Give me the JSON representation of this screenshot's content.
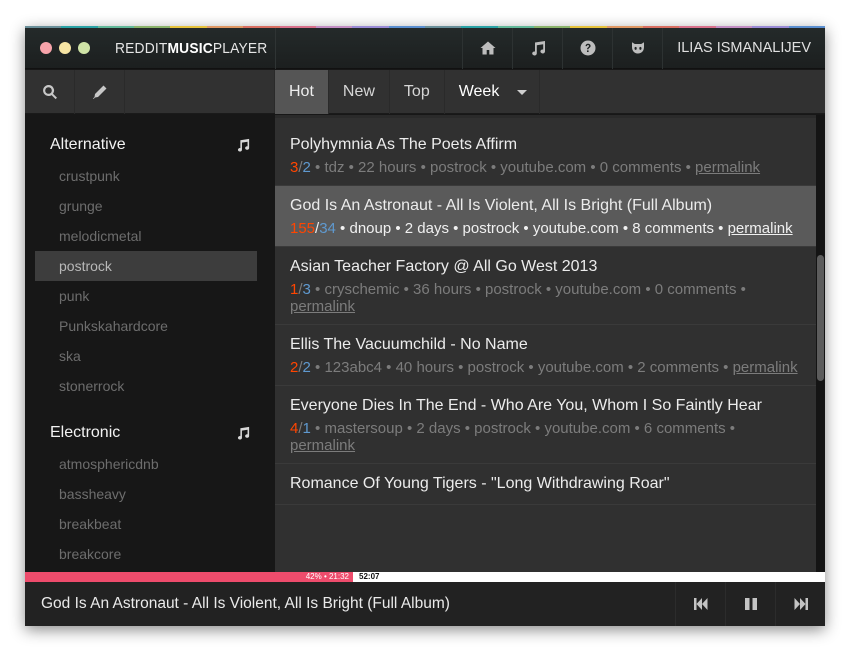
{
  "window": {
    "traffic_lights": [
      {
        "name": "close",
        "color": "#f7a3aa"
      },
      {
        "name": "minimize",
        "color": "#f6e4a3"
      },
      {
        "name": "maximize",
        "color": "#cfe3a6"
      }
    ],
    "rainbow_colors": [
      "#6a8f99",
      "#2ba3a6",
      "#63b99a",
      "#8bb36b",
      "#e7c33c",
      "#e09864",
      "#d96f62",
      "#d9718c",
      "#c48fc5",
      "#9a8bd6",
      "#5b8fd0",
      "#6a8f99",
      "#2ba3a6",
      "#63b99a",
      "#8bb36b",
      "#e7c33c",
      "#e09864",
      "#d96f62",
      "#d9718c",
      "#c48fc5",
      "#9a8bd6",
      "#5b8fd0"
    ]
  },
  "header": {
    "brand_part1": "REDDIT",
    "brand_part2": "MUSIC",
    "brand_part3": "PLAYER",
    "nav_icons": [
      "home-icon",
      "music-icon",
      "help-icon",
      "github-icon"
    ],
    "user_name": "ILIAS ISMANALIJEV"
  },
  "toolbar": {
    "tools": [
      "search-icon",
      "edit-icon"
    ],
    "sort_tabs": [
      {
        "label": "Hot",
        "active": true
      },
      {
        "label": "New",
        "active": false
      },
      {
        "label": "Top",
        "active": false
      }
    ],
    "time_filter": "Week"
  },
  "sidebar": {
    "genres": [
      {
        "name": "Alternative",
        "subs": [
          {
            "label": "crustpunk",
            "active": false
          },
          {
            "label": "grunge",
            "active": false
          },
          {
            "label": "melodicmetal",
            "active": false
          },
          {
            "label": "postrock",
            "active": true
          },
          {
            "label": "punk",
            "active": false
          },
          {
            "label": "Punkskahardcore",
            "active": false
          },
          {
            "label": "ska",
            "active": false
          },
          {
            "label": "stonerrock",
            "active": false
          }
        ]
      },
      {
        "name": "Electronic",
        "subs": [
          {
            "label": "atmosphericdnb",
            "active": false
          },
          {
            "label": "bassheavy",
            "active": false
          },
          {
            "label": "breakbeat",
            "active": false
          },
          {
            "label": "breakcore",
            "active": false
          }
        ]
      }
    ]
  },
  "posts": [
    {
      "title": "Polyhymnia As The Poets Affirm",
      "ups": "3",
      "downs": "2",
      "meta": " • tdz • 22 hours • postrock • youtube.com • 0 comments • ",
      "permalink": "permalink",
      "active": false
    },
    {
      "title": "God Is An Astronaut - All Is Violent, All Is Bright (Full Album)",
      "ups": "155",
      "downs": "34",
      "meta": " • dnoup • 2 days • postrock • youtube.com • 8 comments • ",
      "permalink": "permalink",
      "active": true
    },
    {
      "title": "Asian Teacher Factory @ All Go West 2013",
      "ups": "1",
      "downs": "3",
      "meta": " • cryschemic • 36 hours • postrock • youtube.com • 0 comments • ",
      "permalink": "permalink",
      "active": false
    },
    {
      "title": "Ellis The Vacuumchild - No Name",
      "ups": "2",
      "downs": "2",
      "meta": " • 123abc4 • 40 hours • postrock • youtube.com • 2 comments • ",
      "permalink": "permalink",
      "active": false
    },
    {
      "title": "Everyone Dies In The End - Who Are You, Whom I So Faintly Hear",
      "ups": "4",
      "downs": "1",
      "meta": " • mastersoup • 2 days • postrock • youtube.com • 6 comments • ",
      "permalink": "permalink",
      "active": false
    },
    {
      "title": "Romance Of Young Tigers - \"Long Withdrawing Roar\"",
      "ups": "",
      "downs": "",
      "meta": "",
      "permalink": "",
      "active": false
    }
  ],
  "player": {
    "progress_percent": 42,
    "elapsed_label": "42% • 21:32",
    "total_label": "52:07",
    "now_playing": "God Is An Astronaut - All Is Violent, All Is Bright (Full Album)",
    "controls": [
      "previous-icon",
      "pause-icon",
      "next-icon"
    ],
    "accent_color": "#ee4c6c"
  }
}
